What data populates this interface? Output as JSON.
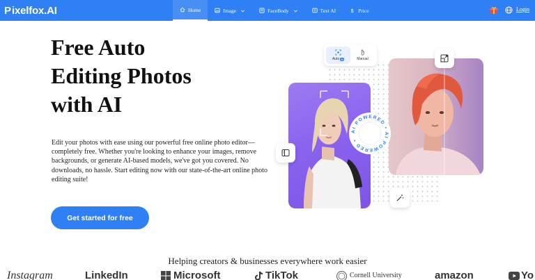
{
  "brand": {
    "mark": "P",
    "name": "ixelfox.AI"
  },
  "nav": {
    "items": [
      {
        "label": "Home"
      },
      {
        "label": "Image"
      },
      {
        "label": "FaceBody"
      },
      {
        "label": "Text AI"
      },
      {
        "label": "Price"
      }
    ],
    "login": "Login"
  },
  "hero": {
    "title_line1": "Free Auto",
    "title_line2": "Editing Photos",
    "title_line3": "with AI",
    "description": "Edit your photos with ease using our powerful free online photo editor—completely free. Whether you're looking to enhance your images, remove backgrounds, or generate AI-based models, we've got you covered. No downloads, no hassle. Start editing now with our state-of-the-art online photo editing suite!",
    "cta": "Get started for free"
  },
  "editor_mockup": {
    "modes": [
      {
        "label": "Auto",
        "pill": "AI"
      },
      {
        "label": "Manual"
      }
    ],
    "badge_text": "AI POWERED • AI POWERED •"
  },
  "trust": {
    "heading": "Helping creators & businesses everywhere work easier",
    "logos": [
      "Instagram",
      "LinkedIn",
      "Microsoft",
      "TikTok",
      "Cornell University",
      "amazon",
      "Yo"
    ]
  },
  "colors": {
    "accent": "#2f80f4",
    "purple": "#8a63ee"
  },
  "icons": [
    "home-icon",
    "image-icon",
    "facebody-icon",
    "text-ai-icon",
    "price-icon",
    "gift-icon",
    "globe-icon"
  ]
}
